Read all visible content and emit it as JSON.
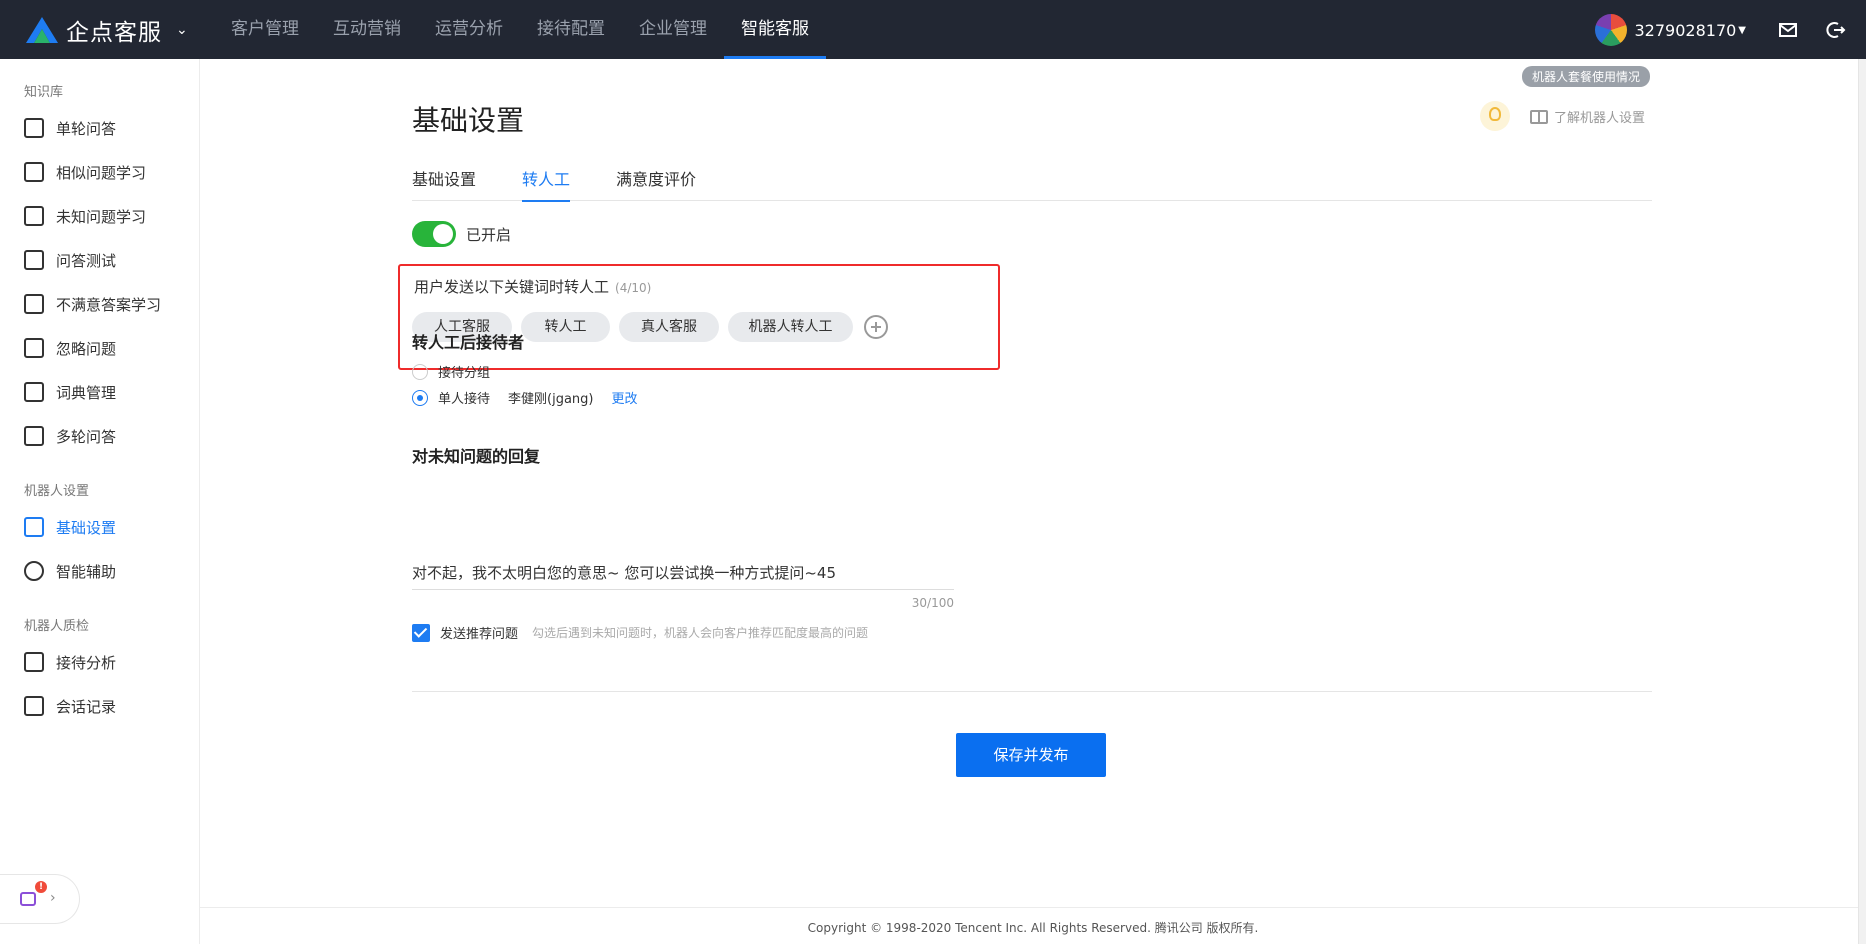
{
  "brand": {
    "name": "企点客服"
  },
  "nav": [
    "客户管理",
    "互动营销",
    "运营分析",
    "接待配置",
    "企业管理",
    "智能客服"
  ],
  "user": {
    "id": "3279028170"
  },
  "sidebar": {
    "group1": "知识库",
    "items1": [
      "单轮问答",
      "相似问题学习",
      "未知问题学习",
      "问答测试",
      "不满意答案学习",
      "忽略问题",
      "词典管理",
      "多轮问答"
    ],
    "group2": "机器人设置",
    "items2": [
      "基础设置",
      "智能辅助"
    ],
    "group3": "机器人质检",
    "items3": [
      "接待分析",
      "会话记录"
    ],
    "widget_badge": "!"
  },
  "main": {
    "usage_badge": "机器人套餐使用情况",
    "title": "基础设置",
    "learn_link": "了解机器人设置",
    "tabs": [
      "基础设置",
      "转人工",
      "满意度评价"
    ],
    "switch_label": "已开启",
    "keywords": {
      "title": "用户发送以下关键词时转人工",
      "count": "(4/10)",
      "chips": [
        "人工客服",
        "转人工",
        "真人客服",
        "机器人转人工"
      ]
    },
    "receiver": {
      "title": "转人工后接待者",
      "option1": "接待分组",
      "option2": "单人接待",
      "person": "李健刚(jgang)",
      "change": "更改"
    },
    "unknown": {
      "title": "对未知问题的回复",
      "reply": "对不起，我不太明白您的意思~ 您可以尝试换一种方式提问~45",
      "count": "30/100",
      "check_label": "发送推荐问题",
      "check_hint": "勾选后遇到未知问题时，机器人会向客户推荐匹配度最高的问题"
    },
    "save": "保存并发布",
    "footer": "Copyright © 1998-2020 Tencent Inc. All Rights Reserved. 腾讯公司 版权所有."
  },
  "colors": {
    "accent": "#1e7cf2",
    "topbar": "#222733",
    "switch_on": "#28b43a",
    "highlight_box": "#ef2b2b"
  }
}
